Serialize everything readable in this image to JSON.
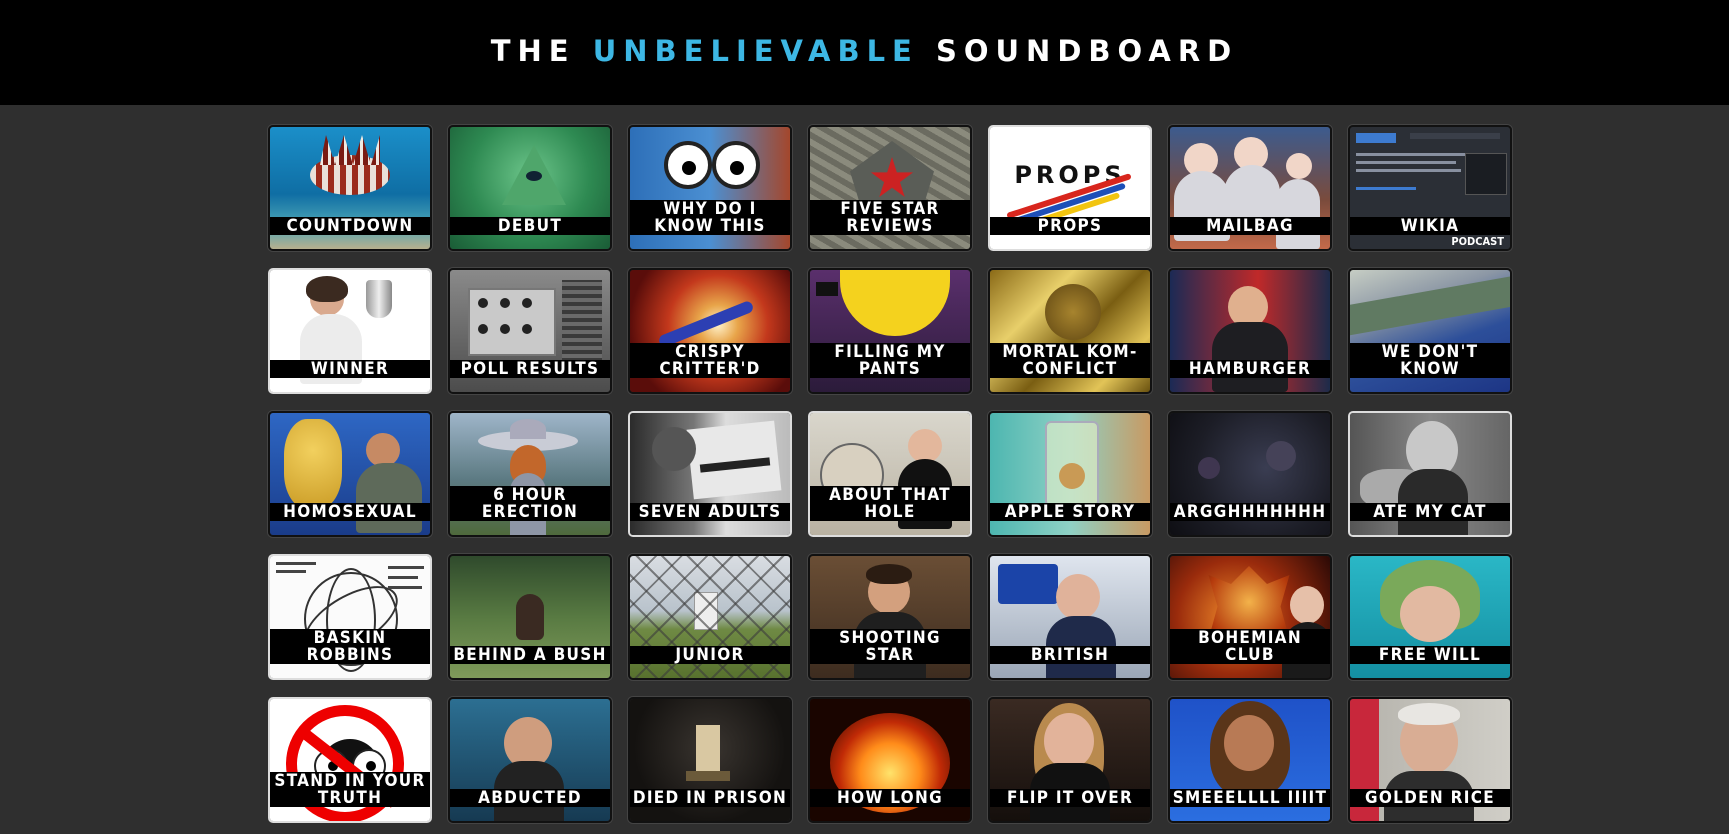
{
  "header": {
    "title_prefix": "THE",
    "title_accent": "UNBELIEVABLE",
    "title_suffix": "SOUNDBOARD"
  },
  "colors": {
    "accent": "#3db7e4",
    "header_bg": "#000000",
    "page_bg": "#2f2f2f"
  },
  "tiles": [
    {
      "label": "COUNTDOWN",
      "icon": "lionfish-image"
    },
    {
      "label": "DEBUT",
      "icon": "dollar-pyramid-eye-image"
    },
    {
      "label": "WHY DO I KNOW THIS",
      "icon": "googly-goggles-image"
    },
    {
      "label": "FIVE STAR REVIEWS",
      "icon": "pentagon-star-image"
    },
    {
      "label": "PROPS",
      "icon": "props-logo-image"
    },
    {
      "label": "MAILBAG",
      "icon": "silver-women-image"
    },
    {
      "label": "WIKIA",
      "icon": "wiki-page-image",
      "sub": "PODCAST"
    },
    {
      "label": "WINNER",
      "icon": "trophy-woman-image"
    },
    {
      "label": "POLL RESULTS",
      "icon": "machine-panel-image"
    },
    {
      "label": "CRISPY CRITTER'D",
      "icon": "explosion-image"
    },
    {
      "label": "FILLING MY PANTS",
      "icon": "yellow-hat-image"
    },
    {
      "label": "MORTAL KOM-CONFLICT",
      "icon": "gold-foil-image"
    },
    {
      "label": "HAMBURGER",
      "icon": "news-host-image"
    },
    {
      "label": "WE DON'T KNOW",
      "icon": "aerial-terrain-image"
    },
    {
      "label": "HOMOSEXUAL",
      "icon": "puppet-show-image"
    },
    {
      "label": "6 HOUR ERECTION",
      "icon": "ufo-woman-image"
    },
    {
      "label": "SEVEN ADULTS",
      "icon": "chimp-newspaper-image"
    },
    {
      "label": "ABOUT THAT HOLE",
      "icon": "satellite-dish-image"
    },
    {
      "label": "APPLE STORY",
      "icon": "jar-image"
    },
    {
      "label": "ARGGHHHHHHH",
      "icon": "dark-scene-image"
    },
    {
      "label": "ATE MY CAT",
      "icon": "bush-cat-image"
    },
    {
      "label": "BASKIN ROBBINS",
      "icon": "flower-diagram-image"
    },
    {
      "label": "BEHIND A BUSH",
      "icon": "bigfoot-image"
    },
    {
      "label": "JUNIOR",
      "icon": "fence-field-image"
    },
    {
      "label": "SHOOTING STAR",
      "icon": "man-guns-image"
    },
    {
      "label": "BRITISH",
      "icon": "radio-host-image"
    },
    {
      "label": "BOHEMIAN CLUB",
      "icon": "owl-statue-image"
    },
    {
      "label": "FREE WILL",
      "icon": "pilot-helmet-image"
    },
    {
      "label": "STAND IN YOUR TRUTH",
      "icon": "no-alien-icon"
    },
    {
      "label": "ABDUCTED",
      "icon": "shouting-man-image"
    },
    {
      "label": "DIED IN PRISON",
      "icon": "prison-cell-image"
    },
    {
      "label": "HOW LONG",
      "icon": "fire-demon-image"
    },
    {
      "label": "FLIP IT OVER",
      "icon": "preacher-image"
    },
    {
      "label": "SMEEELLLL IIIIT",
      "icon": "tyra-image"
    },
    {
      "label": "GOLDEN RICE",
      "icon": "old-man-image"
    }
  ]
}
